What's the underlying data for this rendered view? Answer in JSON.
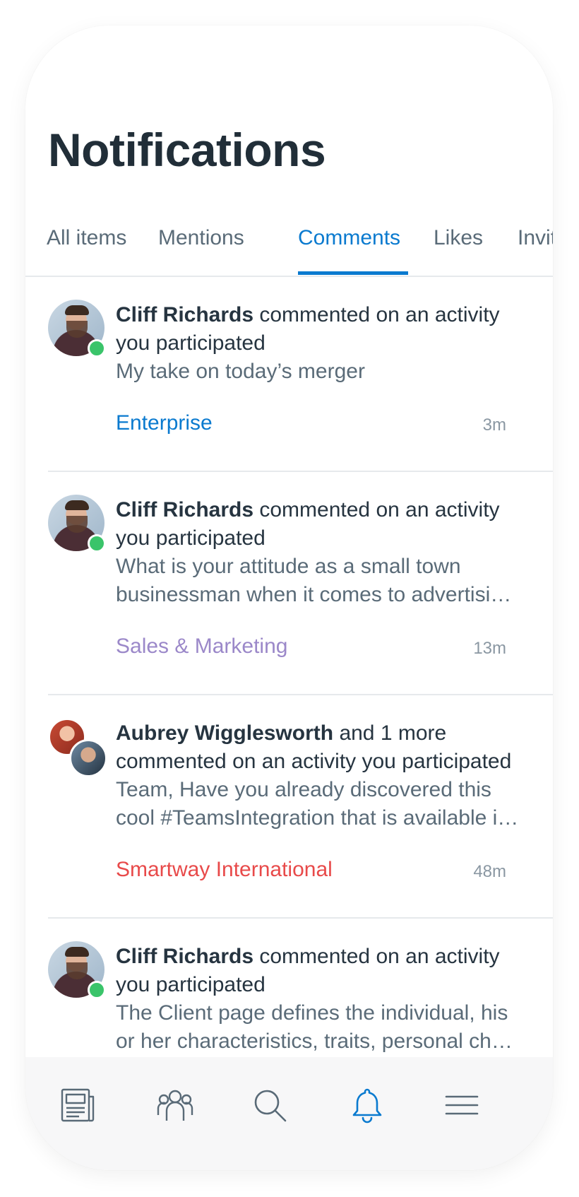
{
  "header": {
    "title": "Notifications"
  },
  "tabs": [
    {
      "label": "All items"
    },
    {
      "label": "Mentions"
    },
    {
      "label": "Comments",
      "active": true
    },
    {
      "label": "Likes"
    },
    {
      "label": "Invites"
    }
  ],
  "notifications": [
    {
      "actor": "Cliff Richards",
      "action": "commented on an activity you participated",
      "preview": "My take on today’s merger",
      "space": "Enterprise",
      "space_color": "#0a7acf",
      "time": "3m"
    },
    {
      "actor": "Cliff Richards",
      "action": "commented on an activity you participated",
      "preview": "What is your attitude as a small town businessman when it comes to advertisi…",
      "space": "Sales & Marketing",
      "space_color": "#9b88c9",
      "time": "13m"
    },
    {
      "actor": "Aubrey Wigglesworth",
      "action": "and 1 more commented on an activity you participated",
      "preview": "Team, Have you already discovered this cool #TeamsIntegration that is available i…",
      "space": "Smartway International",
      "space_color": "#e84a4a",
      "time": "48m"
    },
    {
      "actor": "Cliff Richards",
      "action": "commented on an activity you participated",
      "preview": "The Client page defines the individual, his or her characteristics, traits, personal ch…",
      "space": "",
      "time": ""
    }
  ],
  "bottom_nav": [
    {
      "icon": "news-icon"
    },
    {
      "icon": "people-icon"
    },
    {
      "icon": "search-icon"
    },
    {
      "icon": "bell-icon",
      "active": true
    },
    {
      "icon": "menu-icon"
    }
  ],
  "colors": {
    "accent": "#0a7acf",
    "online": "#3ac46a",
    "text": "#263440",
    "muted": "#5a6b78"
  }
}
